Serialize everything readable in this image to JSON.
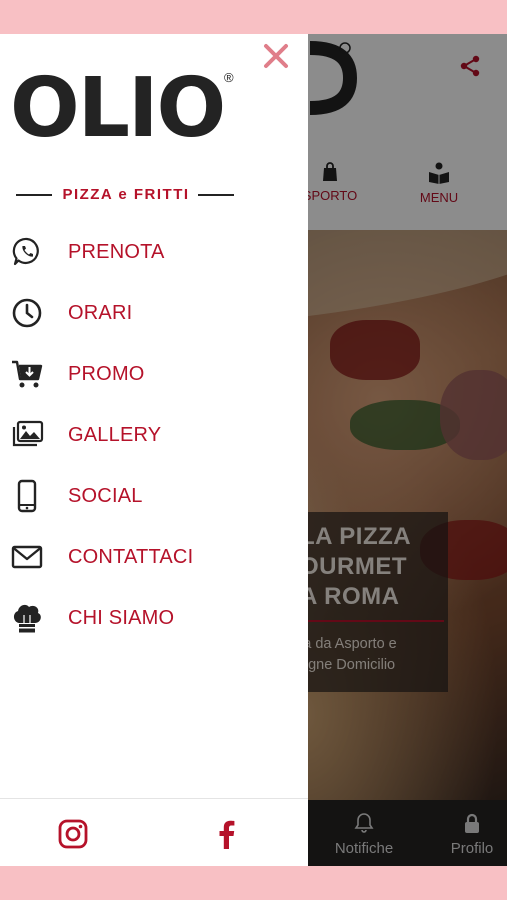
{
  "app": {
    "nav": [
      {
        "label": "SPORTO",
        "icon": "shopping-bag-icon"
      },
      {
        "label": "MENU",
        "icon": "book-reader-icon"
      }
    ],
    "hero": {
      "title_lines": [
        "LA PIZZA",
        "OURMET",
        "A ROMA"
      ],
      "subtitle_lines": [
        "ia da Asporto e",
        "egne Domicilio"
      ]
    },
    "tabbar": [
      {
        "label": "Notifiche",
        "icon": "bell-icon"
      },
      {
        "label": "Profilo",
        "icon": "lock-icon"
      }
    ]
  },
  "drawer": {
    "logo": {
      "wordmark": "OLIO",
      "registered": "®",
      "tagline": "PIZZA e FRITTI"
    },
    "menu": [
      {
        "label": "PRENOTA",
        "icon": "whatsapp-icon"
      },
      {
        "label": "ORARI",
        "icon": "clock-icon"
      },
      {
        "label": "PROMO",
        "icon": "cart-download-icon"
      },
      {
        "label": "GALLERY",
        "icon": "images-icon"
      },
      {
        "label": "SOCIAL",
        "icon": "smartphone-icon"
      },
      {
        "label": "CONTATTACI",
        "icon": "envelope-icon"
      },
      {
        "label": "CHI SIAMO",
        "icon": "chef-hat-icon"
      }
    ],
    "footer": [
      {
        "icon": "instagram-icon"
      },
      {
        "icon": "facebook-icon"
      }
    ]
  },
  "colors": {
    "brand_red": "#b5122a",
    "pink_band": "#f8c0c4",
    "close_pink": "#e07e8a",
    "dark": "#232323"
  }
}
